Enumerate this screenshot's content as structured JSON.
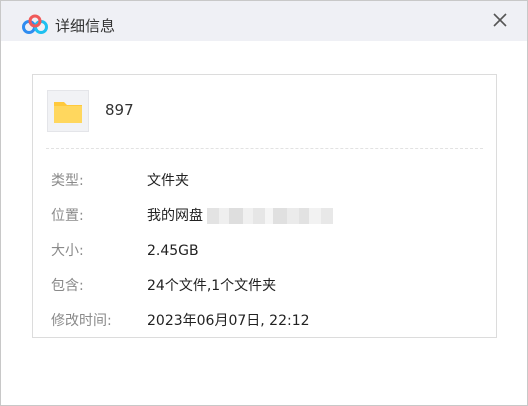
{
  "window": {
    "title": "详细信息",
    "close_glyph": "✕"
  },
  "file": {
    "name": "897",
    "icon": "folder-icon"
  },
  "details": {
    "type_label": "类型:",
    "type_value": "文件夹",
    "location_label": "位置:",
    "location_value": "我的网盘",
    "size_label": "大小:",
    "size_value": "2.45GB",
    "contains_label": "包含:",
    "contains_value": "24个文件,1个文件夹",
    "modified_label": "修改时间:",
    "modified_value": "2023年06月07日, 22:12"
  },
  "colors": {
    "titlebar_bg": "#eff0f5",
    "folder_yellow": "#ffc93c",
    "label_gray": "#8a8a8a"
  }
}
